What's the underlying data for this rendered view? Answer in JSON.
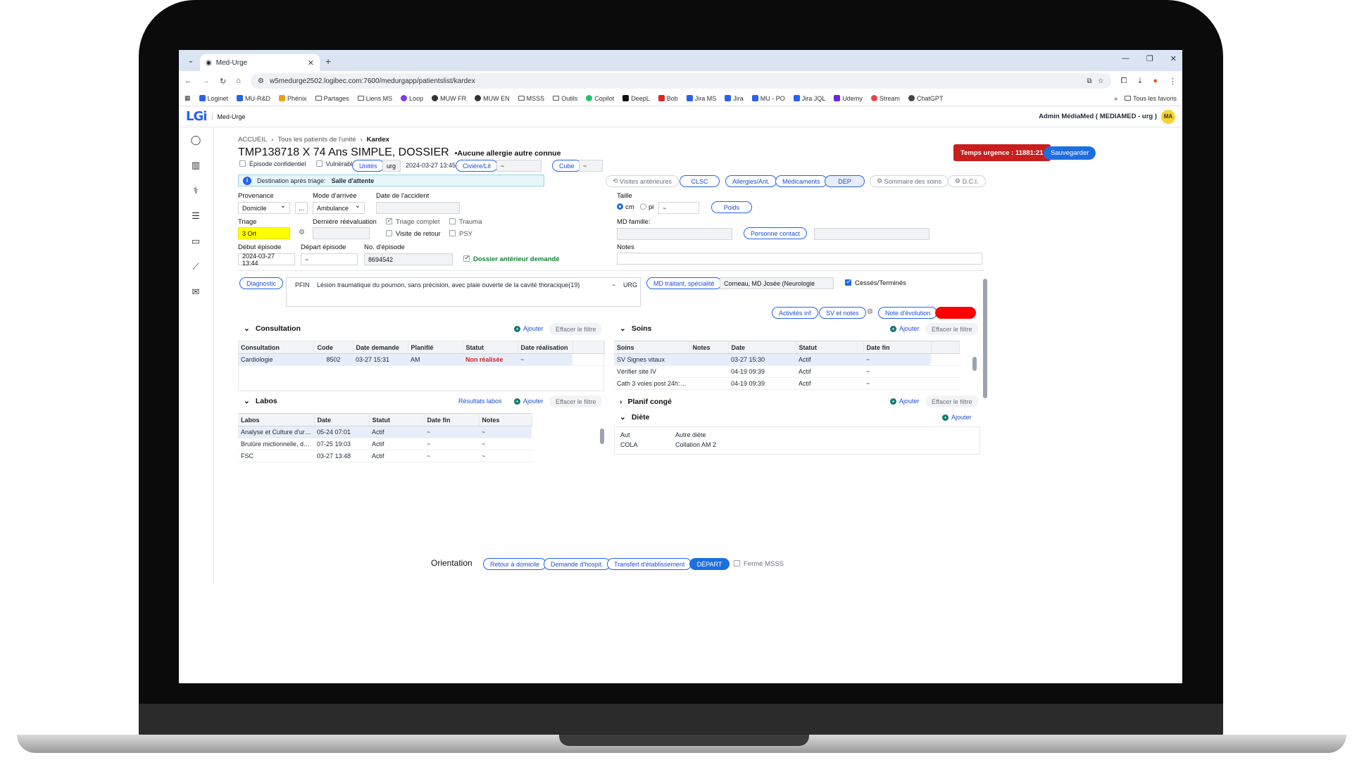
{
  "browser": {
    "tab_title": "Med-Urge",
    "url": "w5medurge2502.logibec.com:7600/medurgapp/patientslist/kardex",
    "bookmarks": [
      "Loginet",
      "MU-R&D",
      "Phénix",
      "Partages",
      "Liens MS",
      "Loop",
      "MUW FR",
      "MUW EN",
      "MSSS",
      "Outils",
      "Copilot",
      "DeepL",
      "Bob",
      "Jira MS",
      "Jira",
      "MU - PO",
      "Jira JQL",
      "Udemy",
      "Stream",
      "ChatGPT"
    ],
    "all_bookmarks": "Tous les favoris"
  },
  "app": {
    "logo": "LGi",
    "name": "Med-Urge",
    "user": "Admin MédiaMed ( MEDIAMED - urg )",
    "avatar": "MA"
  },
  "breadcrumb": {
    "home": "ACCUEIL",
    "patients": "Tous les patients de l'unité",
    "current": "Kardex"
  },
  "patient": {
    "title": "TMP138718 X 74 Ans SIMPLE, DOSSIER",
    "allergy": "•Aucune allergie autre connue",
    "confidential": "Épisode confidentiel",
    "vulnerable": "Vulnérable",
    "unit_value": "urg",
    "datetime": "2024-03-27 13:45",
    "civiere_value": "~",
    "cube_value": "~"
  },
  "buttons": {
    "urgence_timer": "Temps urgence : 11881:21",
    "save": "Sauvegarder",
    "units": "Unités",
    "civiere": "Civière/Lit",
    "cube": "Cube",
    "visites": "Visites antérieures",
    "clsc": "CLSC",
    "allergies": "Allergies/Ant.",
    "medicaments": "Médicaments",
    "dep": "DEP",
    "sommaire": "Sommaire des soins",
    "dci": "D.C.I.",
    "poids": "Poids",
    "personne_contact": "Personne contact",
    "diagnostic": "Diagnostic",
    "md_traitant": "MD traitant, spécialité",
    "activites": "Activités inf",
    "sv_notes": "SV et notes",
    "note_evolution": "Note d'évolution",
    "red_pill": "",
    "add": "Ajouter",
    "clear_filter": "Effacer le filtre",
    "resultats_labos": "Résultats labos"
  },
  "destination": {
    "label": "Destination après triage:",
    "value": "Salle d'attente"
  },
  "form": {
    "provenance_label": "Provenance",
    "provenance": "Domicile",
    "provenance_more": "...",
    "mode_label": "Mode d'arrivée",
    "mode": "Ambulance",
    "accident_label": "Date de l'accident",
    "triage_label": "Triage",
    "triage": "3 Ort",
    "reeval_label": "Dernière réévaluation",
    "triage_complet": "Triage complet",
    "trauma": "Trauma",
    "visite_retour": "Visite de retour",
    "psy": "PSY",
    "debut_label": "Début épisode",
    "debut": "2024-03-27 13:44",
    "depart_label": "Départ épisode",
    "depart": "~",
    "no_label": "No. d'épisode",
    "no": "8694542",
    "dossier_ant": "Dossier antérieur demandé",
    "taille_label": "Taille",
    "cm": "cm",
    "pi": "pi",
    "taille_value": "~",
    "md_famille_label": "MD famille:",
    "notes_label": "Notes"
  },
  "diagnostic": {
    "code": "PFIN",
    "text": "Lésion traumatique du poumon, sans précision, avec plaie ouverte de la cavité thoracique(19)",
    "tilde": "~",
    "type": "URG",
    "md": "Corneau, MD Josée (Neurologie",
    "cesses": "Cessés/Terminés"
  },
  "consultation": {
    "title": "Consultation",
    "columns": [
      "Consultation",
      "Code",
      "Date demande",
      "Planifié",
      "Statut",
      "Date réalisation"
    ],
    "rows": [
      [
        "Cardiologie",
        "8502",
        "03-27 15:31",
        "AM",
        "Non réalisée",
        "~"
      ]
    ]
  },
  "labos": {
    "title": "Labos",
    "columns": [
      "Labos",
      "Date",
      "Statut",
      "Date fin",
      "Notes"
    ],
    "rows": [
      [
        "Analyse et Culture d'urine",
        "05-24 07:01",
        "Actif",
        "~",
        "~"
      ],
      [
        "Brulûre mictionnelle, dys...",
        "07-25 19:03",
        "Actif",
        "~",
        "~"
      ],
      [
        "FSC",
        "03-27 13:48",
        "Actif",
        "~",
        "~"
      ]
    ]
  },
  "soins": {
    "title": "Soins",
    "columns": [
      "Soins",
      "Notes",
      "Date",
      "Statut",
      "Date fin"
    ],
    "rows": [
      [
        "SV Signes vitaux",
        "",
        "03-27 15:30",
        "Actif",
        "~"
      ],
      [
        "Vérifier site IV",
        "",
        "04-19 09:39",
        "Actif",
        "~"
      ],
      [
        "Cath 3 voies post 24h: c...",
        "",
        "04-19 09:39",
        "Actif",
        "~"
      ]
    ]
  },
  "planif_conge": {
    "title": "Planif congé"
  },
  "diete": {
    "title": "Diète",
    "rows": [
      [
        "Aut",
        "Autre diète"
      ],
      [
        "COLA",
        "Collation AM 2"
      ]
    ]
  },
  "orientation": {
    "label": "Orientation",
    "retour": "Retour à domicile",
    "demande": "Demande d'hospit.",
    "transfert": "Transfert d'établissement",
    "depart": "DÉPART",
    "ferme": "Fermé MSSS"
  },
  "colors": {
    "accent": "#1d6fe0",
    "danger": "#c81e1e",
    "triage": "#ffff00"
  }
}
